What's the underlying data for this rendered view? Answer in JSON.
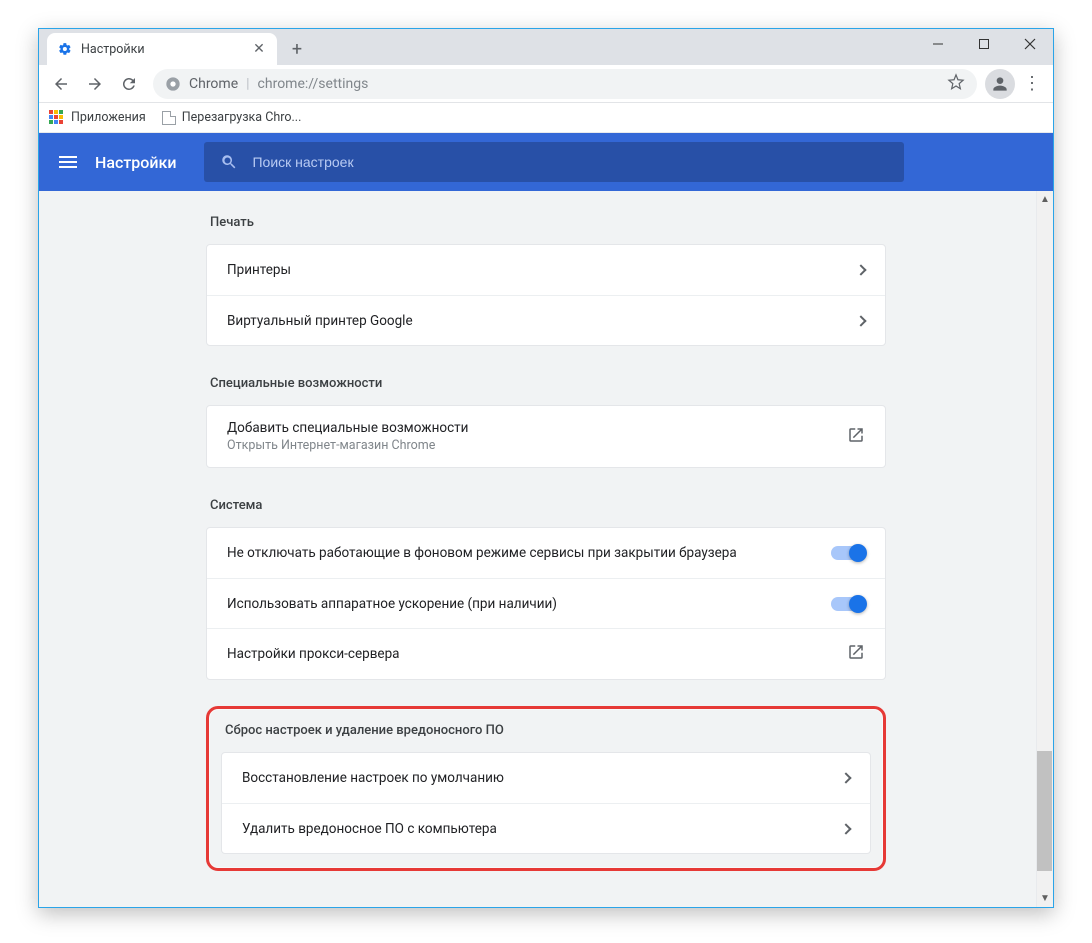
{
  "window": {
    "tab_title": "Настройки"
  },
  "toolbar": {
    "chrome_label": "Chrome",
    "url": "chrome://settings"
  },
  "bookmarks": {
    "apps": "Приложения",
    "item1": "Перезагрузка Chro..."
  },
  "header": {
    "title": "Настройки",
    "search_placeholder": "Поиск настроек"
  },
  "sections": {
    "print": {
      "title": "Печать",
      "rows": {
        "printers": "Принтеры",
        "cloud_print": "Виртуальный принтер Google"
      }
    },
    "accessibility": {
      "title": "Специальные возможности",
      "row_title": "Добавить специальные возможности",
      "row_sub": "Открыть Интернет-магазин Chrome"
    },
    "system": {
      "title": "Система",
      "bg_services": "Не отключать работающие в фоновом режиме сервисы при закрытии браузера",
      "hw_accel": "Использовать аппаратное ускорение (при наличии)",
      "proxy": "Настройки прокси-сервера"
    },
    "reset": {
      "title": "Сброс настроек и удаление вредоносного ПО",
      "restore": "Восстановление настроек по умолчанию",
      "cleanup": "Удалить вредоносное ПО с компьютера"
    }
  }
}
